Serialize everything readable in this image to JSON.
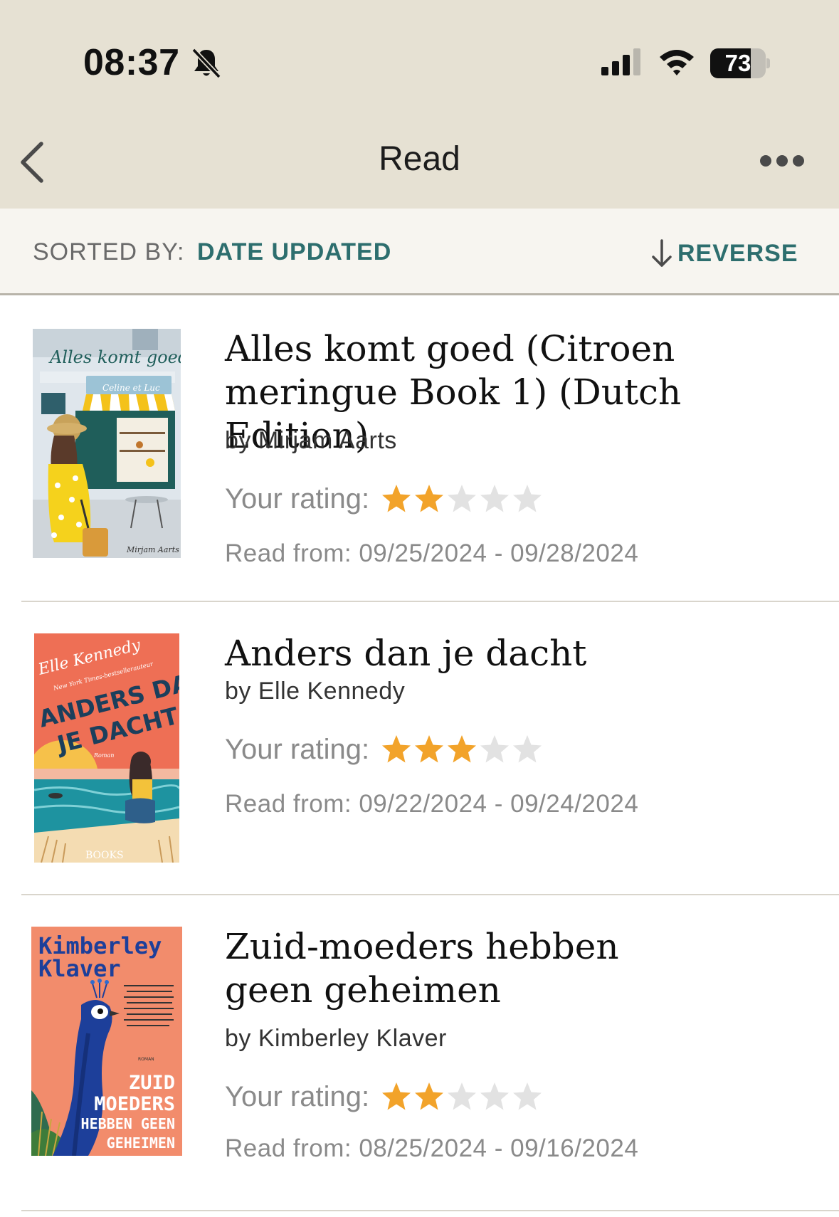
{
  "status_bar": {
    "time": "08:37",
    "battery": "73",
    "battery_level": 0.73
  },
  "header": {
    "title": "Read"
  },
  "sort_bar": {
    "label": "SORTED BY:",
    "value": "DATE UPDATED",
    "reverse_label": "REVERSE"
  },
  "books": [
    {
      "title": "Alles komt goed (Citroen meringue Book 1) (Dutch Edition)",
      "author": "by Mirjam Aarts",
      "rating_label": "Your rating:",
      "rating": 2,
      "rating_max": 5,
      "dates": "Read from: 09/25/2024 - 09/28/2024",
      "cover": {
        "title_text": "Alles komt goed",
        "shop_text": "Celine et Luc",
        "author_text": "Mirjam Aarts"
      }
    },
    {
      "title": "Anders dan je dacht",
      "author": "by Elle Kennedy",
      "rating_label": "Your rating:",
      "rating": 3,
      "rating_max": 5,
      "dates": "Read from: 09/22/2024 - 09/24/2024",
      "cover": {
        "author_text": "Elle Kennedy",
        "tagline": "New York Times-bestsellerauteur",
        "title_line1": "ANDERS DAN",
        "title_line2": "JE DACHT",
        "genre": "Roman",
        "publisher": "BOOKS"
      }
    },
    {
      "title": "Zuid-moeders hebben geen geheimen",
      "author": "by Kimberley Klaver",
      "rating_label": "Your rating:",
      "rating": 2,
      "rating_max": 5,
      "dates": "Read from: 08/25/2024 - 09/16/2024",
      "cover": {
        "author_line1": "Kimberley",
        "author_line2": "Klaver",
        "genre": "ROMAN",
        "title_line1": "ZUID",
        "title_line2": "MOEDERS",
        "title_line3": "HEBBEN GEEN",
        "title_line4": "GEHEIMEN"
      }
    }
  ],
  "colors": {
    "header_bg": "#e6e1d3",
    "accent": "#2d6e6e",
    "star_on": "#f2a32a",
    "star_off": "#e2e2e2"
  }
}
